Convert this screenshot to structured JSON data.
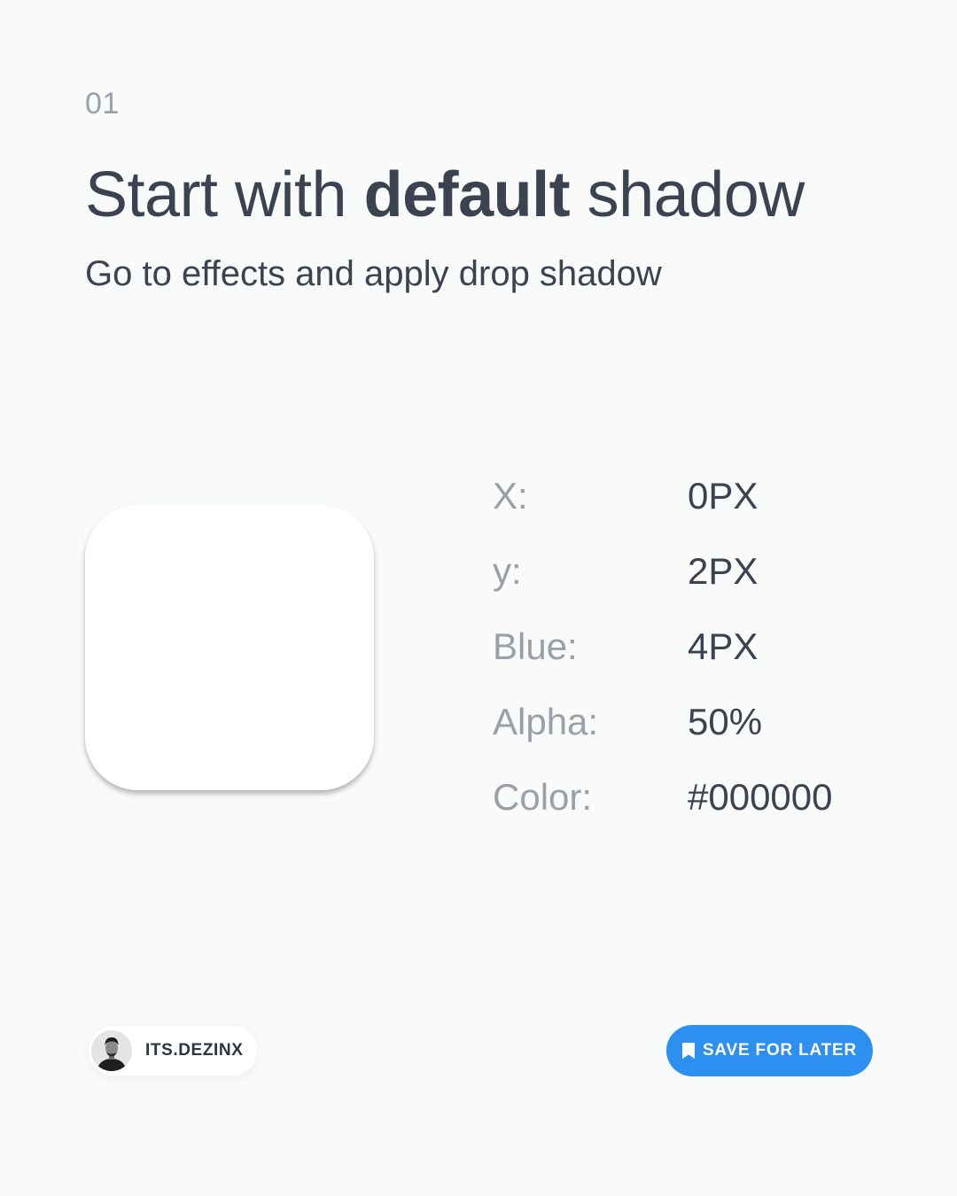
{
  "step": {
    "number": "01"
  },
  "title": {
    "prefix": "Start with ",
    "bold": "default",
    "suffix": " shadow"
  },
  "subtitle": "Go to effects and apply drop shadow",
  "shadow_properties": [
    {
      "label": "X:",
      "value": "0PX"
    },
    {
      "label": "y:",
      "value": "2PX"
    },
    {
      "label": "Blue:",
      "value": "4PX"
    },
    {
      "label": "Alpha:",
      "value": "50%"
    },
    {
      "label": "Color:",
      "value": "#000000"
    }
  ],
  "author": {
    "name": "ITS.DEZINX",
    "avatar_icon": "person-avatar"
  },
  "save_button": {
    "label": "SAVE FOR LATER",
    "icon": "bookmark-icon"
  },
  "colors": {
    "background": "#f9fafa",
    "text_dark": "#3b4250",
    "text_muted": "#9aa0a8",
    "accent": "#2d8ff0",
    "card": "#ffffff"
  }
}
